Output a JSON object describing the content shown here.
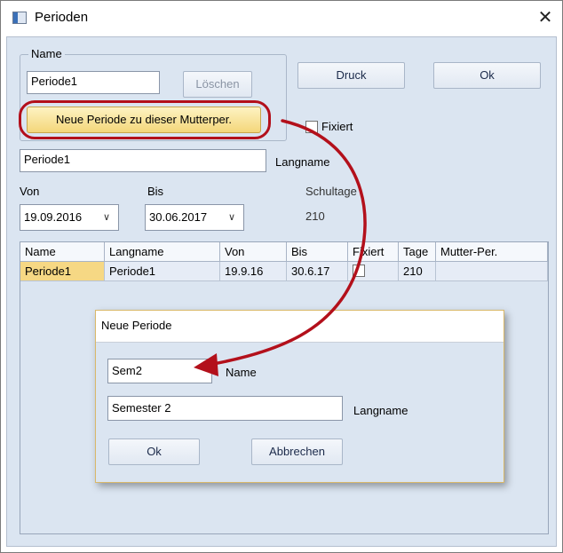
{
  "window": {
    "title": "Perioden",
    "close_glyph": "✕"
  },
  "name_group": {
    "label": "Name",
    "name_value": "Periode1",
    "delete_label": "Löschen"
  },
  "buttons": {
    "print_label": "Druck",
    "ok_label": "Ok"
  },
  "new_period_button": "Neue Periode zu dieser Mutterper.",
  "fixed_label": "Fixiert",
  "longname": {
    "value": "Periode1",
    "label": "Langname"
  },
  "dates": {
    "from_label": "Von",
    "from_value": "19.09.2016",
    "to_label": "Bis",
    "to_value": "30.06.2017",
    "schooldays_label": "Schultage",
    "schooldays_value": "210"
  },
  "table": {
    "columns": [
      "Name",
      "Langname",
      "Von",
      "Bis",
      "Fixiert",
      "Tage",
      "Mutter-Per."
    ],
    "rows": [
      {
        "name": "Periode1",
        "langname": "Periode1",
        "von": "19.9.16",
        "bis": "30.6.17",
        "fixiert": false,
        "tage": "210",
        "mutter": ""
      }
    ]
  },
  "dialog": {
    "title": "Neue Periode",
    "name_value": "Sem2",
    "name_label": "Name",
    "longname_value": "Semester 2",
    "longname_label": "Langname",
    "ok_label": "Ok",
    "cancel_label": "Abbrechen"
  },
  "colors": {
    "accent_red": "#b3101b",
    "highlight_yellow": "#f4d77a",
    "panel_bg": "#dbe5f1"
  },
  "icons": [
    "app-window-icon",
    "close-icon",
    "chevron-down-icon"
  ]
}
